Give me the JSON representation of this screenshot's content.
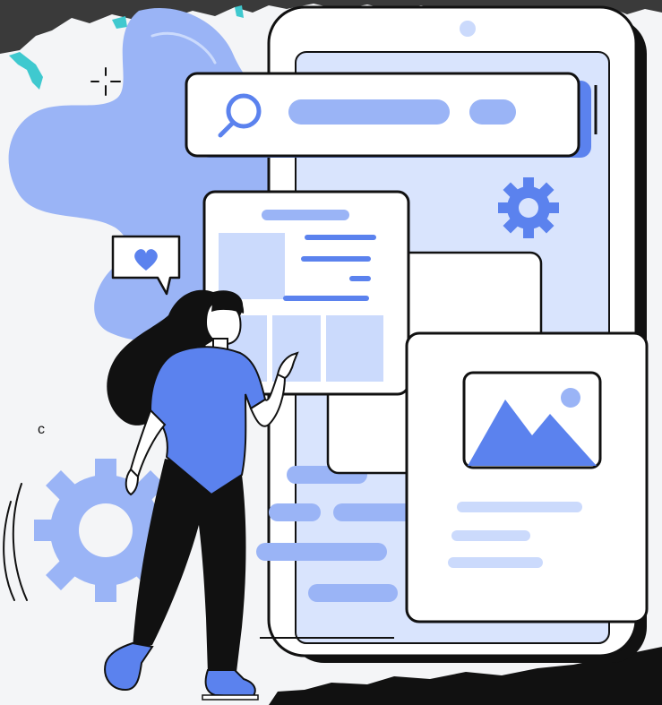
{
  "illustration": {
    "subject": "person-interacting-with-mobile-ui",
    "icons": [
      "search-icon",
      "gear-icon",
      "heart-icon",
      "image-icon"
    ]
  },
  "colors": {
    "accent": "#5b82ee",
    "accent_light": "#9ab4f6",
    "accent_pale": "#cbdafc",
    "phone_screen": "#d9e4fd",
    "outline": "#111111",
    "card": "#ffffff",
    "paper": "#f4f5f7"
  }
}
